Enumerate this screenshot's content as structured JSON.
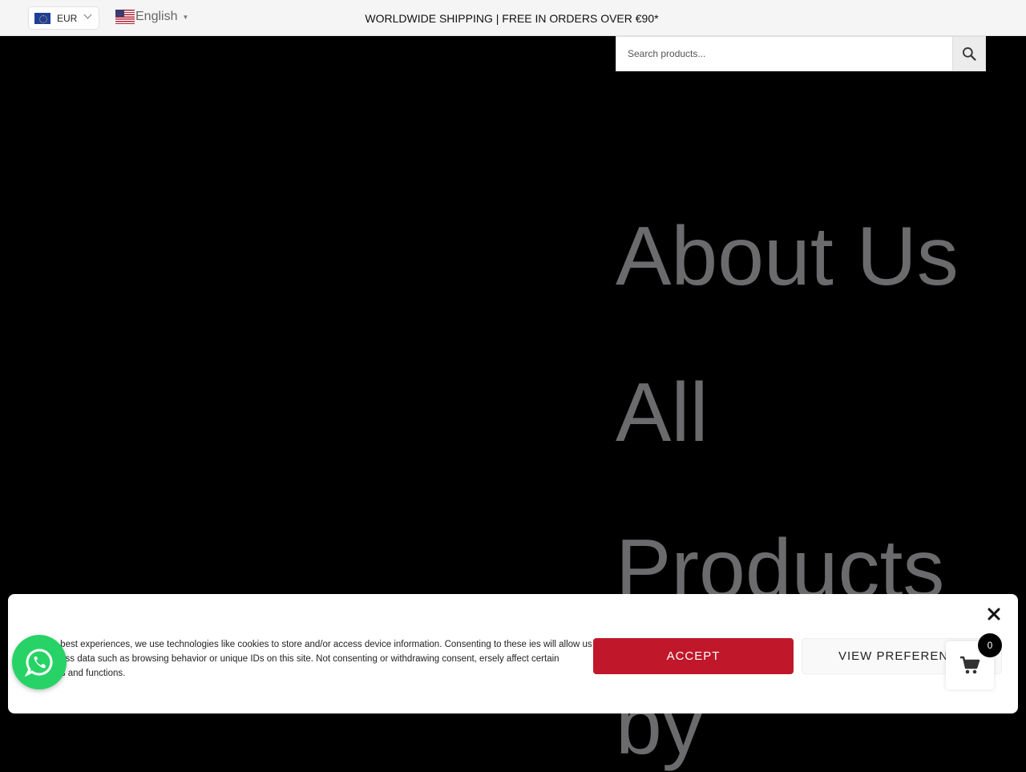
{
  "topbar": {
    "currency": {
      "code": "EUR",
      "flag": "eu-flag"
    },
    "language": {
      "label": "English",
      "caret": "▼",
      "flag": "us-flag"
    },
    "shipping_notice": "WORLDWIDE SHIPPING | FREE IN ORDERS OVER €90*"
  },
  "search": {
    "placeholder": "Search products...",
    "icon": "search-icon"
  },
  "menu": {
    "items": [
      "About Us",
      "All",
      "Products",
      "by"
    ]
  },
  "cookie_banner": {
    "text": "de the best experiences, we use technologies like cookies to store and/or access device information. Consenting to these ies will allow us to process data such as browsing behavior or unique IDs on this site. Not consenting or withdrawing consent, ersely affect certain features and functions.",
    "accept_label": "ACCEPT",
    "preferences_label": "VIEW PREFERENCES",
    "accent_color": "#c0182a"
  },
  "cart": {
    "count": "0",
    "icon": "cart-icon"
  },
  "whatsapp": {
    "icon": "whatsapp-icon",
    "color": "#27d366"
  }
}
